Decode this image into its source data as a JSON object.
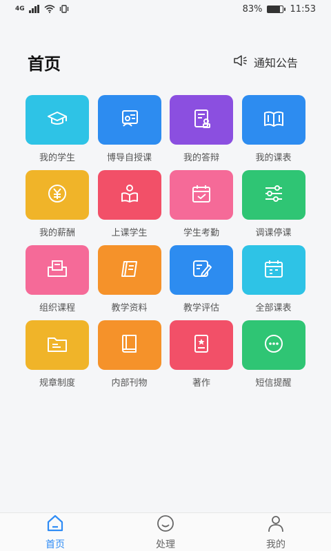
{
  "status": {
    "network": "4G",
    "battery": "83%",
    "battery_level": 0.83,
    "time": "11:53"
  },
  "header": {
    "title": "首页",
    "notice_label": "通知公告",
    "notice_icon": "speaker-icon"
  },
  "grid": [
    {
      "label": "我的学生",
      "color": "#2ec3e6",
      "icon": "graduation-cap-icon"
    },
    {
      "label": "博导自授课",
      "color": "#2d8cf0",
      "icon": "presentation-icon"
    },
    {
      "label": "我的答辩",
      "color": "#8b4fe0",
      "icon": "defense-document-icon"
    },
    {
      "label": "我的课表",
      "color": "#2d8cf0",
      "icon": "open-book-icon"
    },
    {
      "label": "我的薪酬",
      "color": "#f0b429",
      "icon": "yuan-coin-icon"
    },
    {
      "label": "上课学生",
      "color": "#f25068",
      "icon": "reading-student-icon"
    },
    {
      "label": "学生考勤",
      "color": "#f56a98",
      "icon": "calendar-check-icon"
    },
    {
      "label": "调课停课",
      "color": "#2fc574",
      "icon": "sliders-icon"
    },
    {
      "label": "组织课程",
      "color": "#f56a98",
      "icon": "inbox-document-icon"
    },
    {
      "label": "教学资料",
      "color": "#f5922a",
      "icon": "notebook-icon"
    },
    {
      "label": "教学评估",
      "color": "#2d8cf0",
      "icon": "edit-form-icon"
    },
    {
      "label": "全部课表",
      "color": "#2ec3e6",
      "icon": "calendar-icon"
    },
    {
      "label": "规章制度",
      "color": "#f0b429",
      "icon": "folder-icon"
    },
    {
      "label": "内部刊物",
      "color": "#f5922a",
      "icon": "book-icon"
    },
    {
      "label": "著作",
      "color": "#f25068",
      "icon": "award-document-icon"
    },
    {
      "label": "短信提醒",
      "color": "#2fc574",
      "icon": "chat-dots-icon"
    }
  ],
  "tabs": [
    {
      "label": "首页",
      "icon": "home-icon",
      "active": true
    },
    {
      "label": "处理",
      "icon": "smile-icon",
      "active": false
    },
    {
      "label": "我的",
      "icon": "person-icon",
      "active": false
    }
  ],
  "colors": {
    "accent": "#2f8cf5",
    "background": "#f5f6f8"
  }
}
